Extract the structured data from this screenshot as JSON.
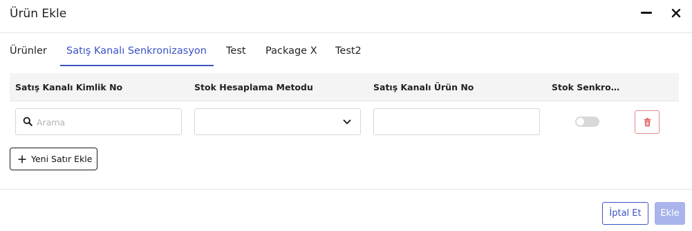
{
  "dialog": {
    "title": "Ürün Ekle"
  },
  "tabs": [
    {
      "label": "Ürünler",
      "active": false
    },
    {
      "label": "Satış Kanalı Senkronizasyon",
      "active": true
    },
    {
      "label": "Test",
      "active": false
    },
    {
      "label": "Package X",
      "active": false
    },
    {
      "label": "Test2",
      "active": false
    }
  ],
  "table": {
    "headers": [
      "Satış Kanalı Kimlik No",
      "Stok Hesaplama Metodu",
      "Satış Kanalı Ürün No",
      "Stok Senkronizasyonu"
    ],
    "row": {
      "search_placeholder": "Arama",
      "search_value": "",
      "stock_method_value": "",
      "channel_product_no": "",
      "stock_sync_enabled": false
    }
  },
  "actions": {
    "add_row_label": "Yeni Satır Ekle",
    "cancel_label": "İptal Et",
    "submit_label": "Ekle"
  },
  "colors": {
    "accent": "#3b52c4",
    "submit_disabled_bg": "#a9b4ec",
    "delete_border": "#e08a8a",
    "delete_icon": "#e06060",
    "header_bg": "#f4f4f4"
  },
  "icons": {
    "minimize": "minimize-icon",
    "close": "close-icon",
    "search": "search-icon",
    "dropdown": "chevron-down-icon",
    "delete": "trash-icon",
    "add": "plus-icon"
  }
}
